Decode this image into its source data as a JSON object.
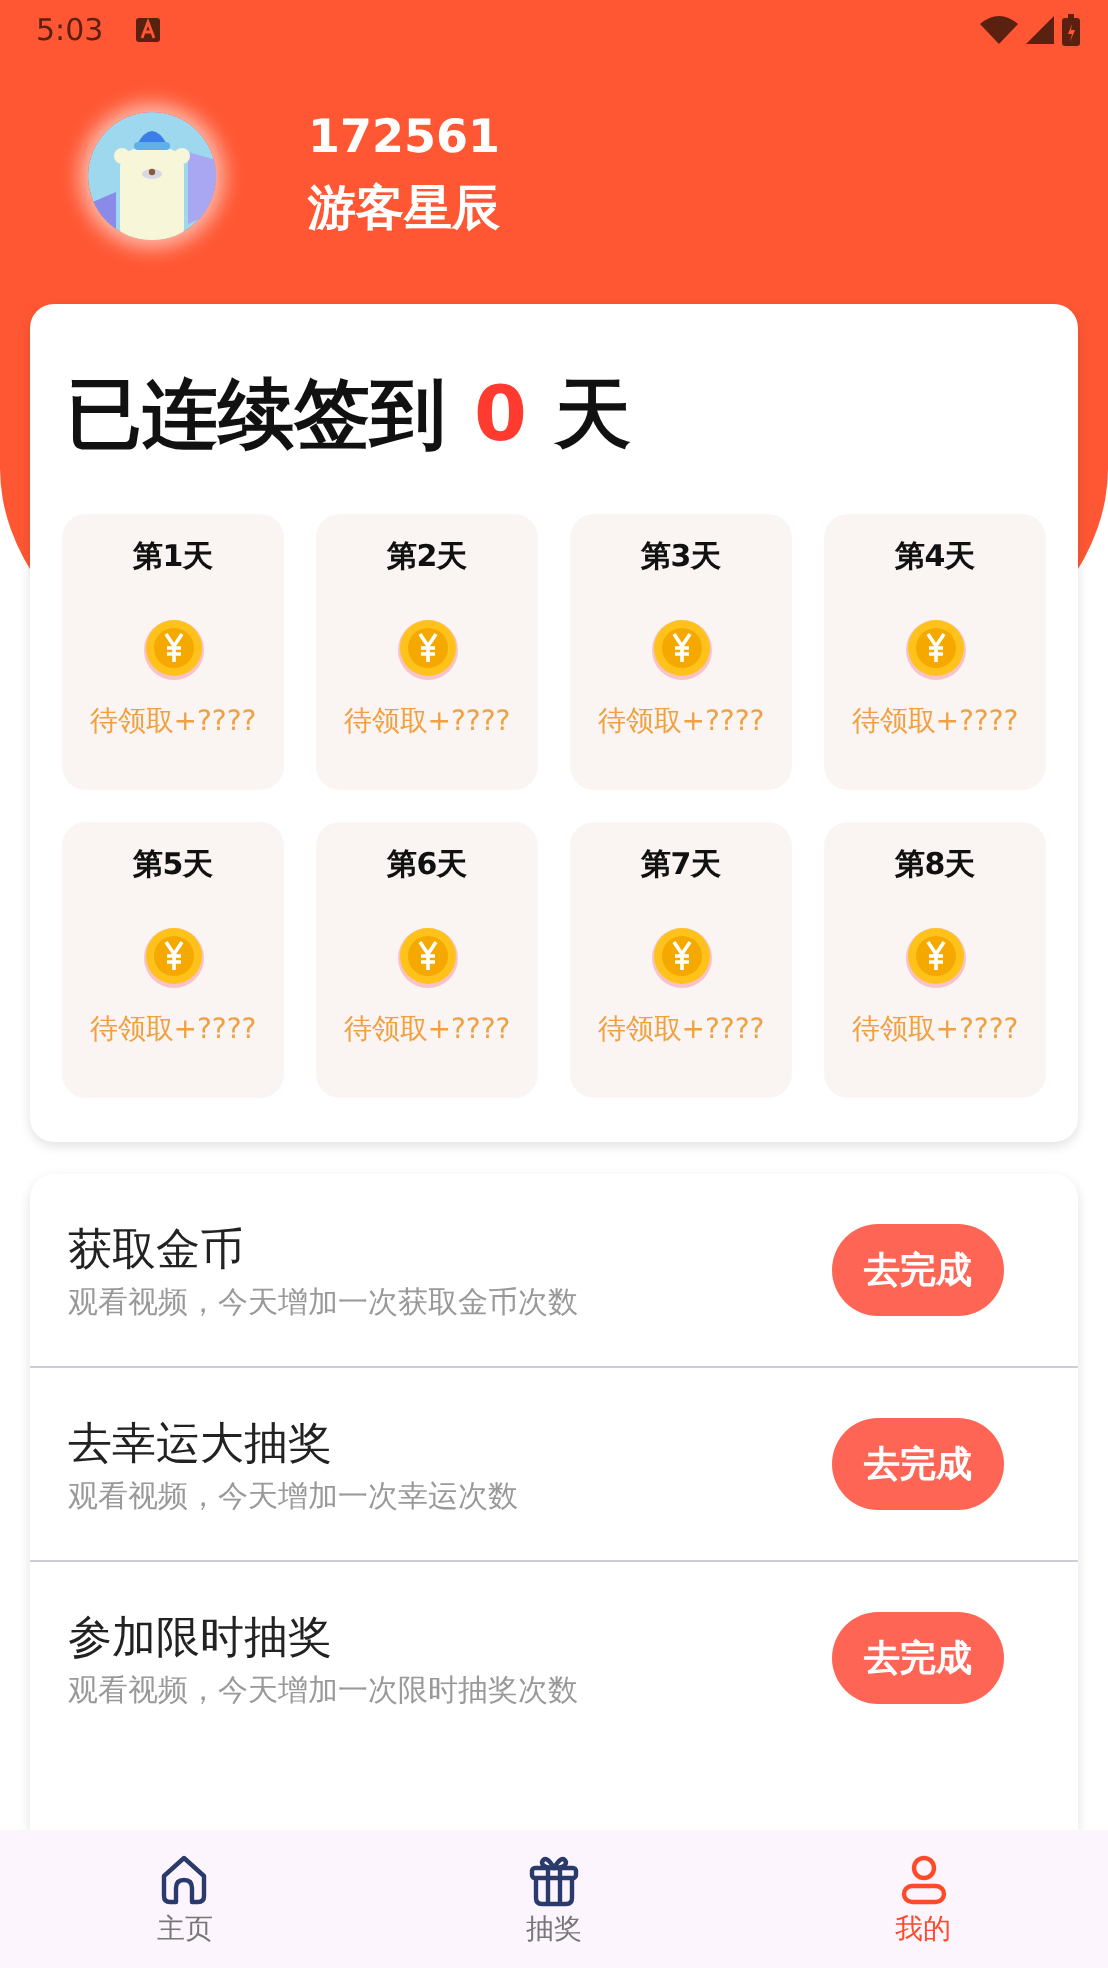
{
  "status_bar": {
    "time": "5:03"
  },
  "profile": {
    "user_id": "172561",
    "nickname": "游客星辰"
  },
  "checkin": {
    "prefix": "已连续签到",
    "count": "0",
    "suffix": "天",
    "days": [
      {
        "label": "第1天",
        "reward": "待领取+????"
      },
      {
        "label": "第2天",
        "reward": "待领取+????"
      },
      {
        "label": "第3天",
        "reward": "待领取+????"
      },
      {
        "label": "第4天",
        "reward": "待领取+????"
      },
      {
        "label": "第5天",
        "reward": "待领取+????"
      },
      {
        "label": "第6天",
        "reward": "待领取+????"
      },
      {
        "label": "第7天",
        "reward": "待领取+????"
      },
      {
        "label": "第8天",
        "reward": "待领取+????"
      }
    ]
  },
  "tasks": [
    {
      "title": "获取金币",
      "description": "观看视频，今天增加一次获取金币次数",
      "button": "去完成"
    },
    {
      "title": "去幸运大抽奖",
      "description": "观看视频，今天增加一次幸运次数",
      "button": "去完成"
    },
    {
      "title": "参加限时抽奖",
      "description": "观看视频，今天增加一次限时抽奖次数",
      "button": "去完成"
    }
  ],
  "bottom_nav": [
    {
      "label": "主页",
      "kind": "home",
      "selected": false
    },
    {
      "label": "抽奖",
      "kind": "gift",
      "selected": false
    },
    {
      "label": "我的",
      "kind": "user",
      "selected": true
    }
  ]
}
